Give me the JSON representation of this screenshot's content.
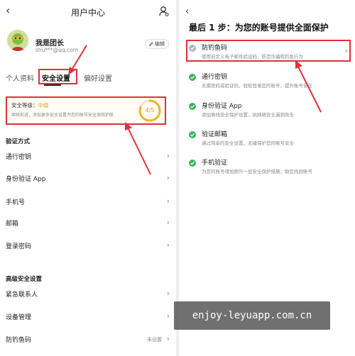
{
  "left": {
    "header": {
      "back_glyph": "‹",
      "title": "用户中心"
    },
    "profile": {
      "name": "我是团长",
      "email": "shu***@qq.com",
      "edit_label": "编辑"
    },
    "tabs": [
      {
        "label": "个人资料"
      },
      {
        "label": "安全设置",
        "active": true
      },
      {
        "label": "偏好设置"
      }
    ],
    "security": {
      "level_label": "安全等级：",
      "level_value": "中级",
      "description": "继续前进，添加更多安全设置为您的账号安全保驾护航",
      "score_text": "4/5",
      "score_fraction": 0.8
    },
    "verify_section_title": "验证方式",
    "verify_items": [
      {
        "label": "通行密钥"
      },
      {
        "label": "身份验证 App"
      },
      {
        "label": "手机号"
      },
      {
        "label": "邮箱"
      },
      {
        "label": "登录密码"
      }
    ],
    "advanced_section_title": "高级安全设置",
    "advanced_items": [
      {
        "label": "紧急联系人",
        "status": ""
      },
      {
        "label": "设备管理",
        "status": ""
      },
      {
        "label": "防钓鱼码",
        "status": "未设置"
      }
    ]
  },
  "right": {
    "back_glyph": "‹",
    "title": "最后 1 步：为您的账号提供全面保护",
    "items": [
      {
        "title": "防钓鱼码",
        "desc": "使用自定义电子邮件验证码，防范诈骗和钓鱼行为",
        "status": "pending"
      },
      {
        "title": "通行密钥",
        "desc": "无需密码或验证码，轻松登录您的账号，提升账号安全",
        "status": "done"
      },
      {
        "title": "身份验证 App",
        "desc": "添加离线安全保护设置，抗网络安全漏洞攻击",
        "status": "done"
      },
      {
        "title": "验证邮箱",
        "desc": "通过简单的安全设置，无缝保护您的账号安全",
        "status": "done"
      },
      {
        "title": "手机验证",
        "desc": "为您的账号增加额外一层安全保护措施，助您找回账号",
        "status": "done"
      }
    ]
  },
  "watermark": "enjoy-leyuapp.com.cn",
  "colors": {
    "highlight": "#e0303a",
    "success": "#3bb45b",
    "gauge": "#f0b429"
  }
}
